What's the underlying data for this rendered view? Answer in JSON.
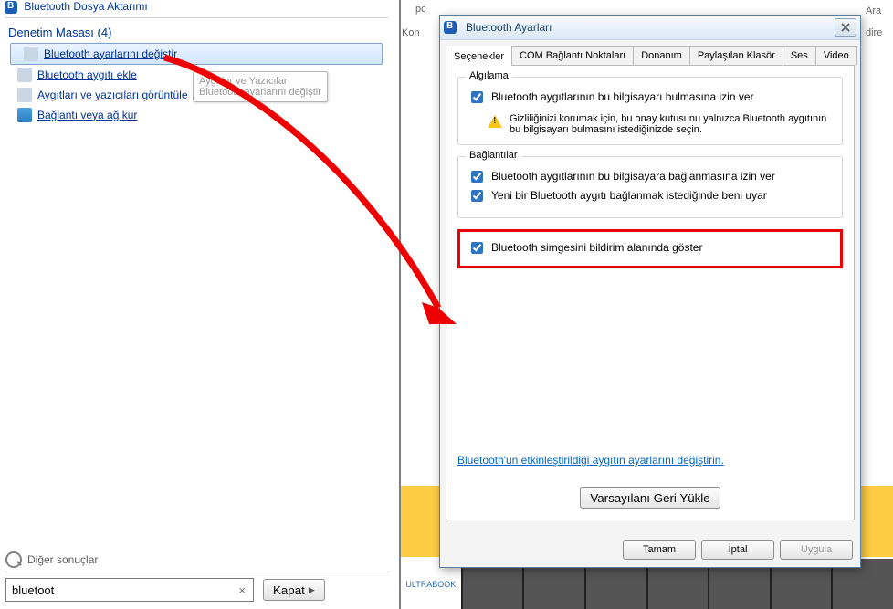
{
  "left": {
    "top_crumb": "Bluetooth Dosya Aktarımı",
    "header": "Denetim Masası (4)",
    "items": [
      "Bluetooth ayarlarını değiştir",
      "Bluetooth aygıtı ekle",
      "Aygıtları ve yazıcıları görüntüle",
      "Bağlantı veya ağ kur"
    ],
    "tooltip_line1": "Aygıtlar ve Yazıcılar",
    "tooltip_line2": "Bluetooth ayarlarını değiştir",
    "other_results": "Diğer sonuçlar",
    "search_value": "bluetoot",
    "close_button": "Kapat"
  },
  "bg": {
    "pc": "pc",
    "kon": "Kon",
    "dire": "dire",
    "ara": "Ara",
    "ultra": "ULTRABOOK"
  },
  "dialog": {
    "title": "Bluetooth Ayarları",
    "tabs": [
      "Seçenekler",
      "COM Bağlantı Noktaları",
      "Donanım",
      "Paylaşılan Klasör",
      "Ses",
      "Video"
    ],
    "group_detect": "Algılama",
    "chk_detect": "Bluetooth aygıtlarının bu bilgisayarı bulmasına izin ver",
    "warn_text": "Gizliliğinizi korumak için, bu onay kutusunu yalnızca Bluetooth aygıtının bu bilgisayarı bulmasını istediğinizde seçin.",
    "group_conn": "Bağlantılar",
    "chk_conn1": "Bluetooth aygıtlarının bu bilgisayara bağlanmasına izin ver",
    "chk_conn2": "Yeni bir Bluetooth aygıtı bağlanmak istediğinde beni uyar",
    "chk_tray": "Bluetooth simgesini bildirim alanında göster",
    "link_text": "Bluetooth'un etkinleştirildiği aygıtın ayarlarını değiştirin.",
    "restore": "Varsayılanı Geri Yükle",
    "ok": "Tamam",
    "cancel": "İptal",
    "apply": "Uygula"
  }
}
